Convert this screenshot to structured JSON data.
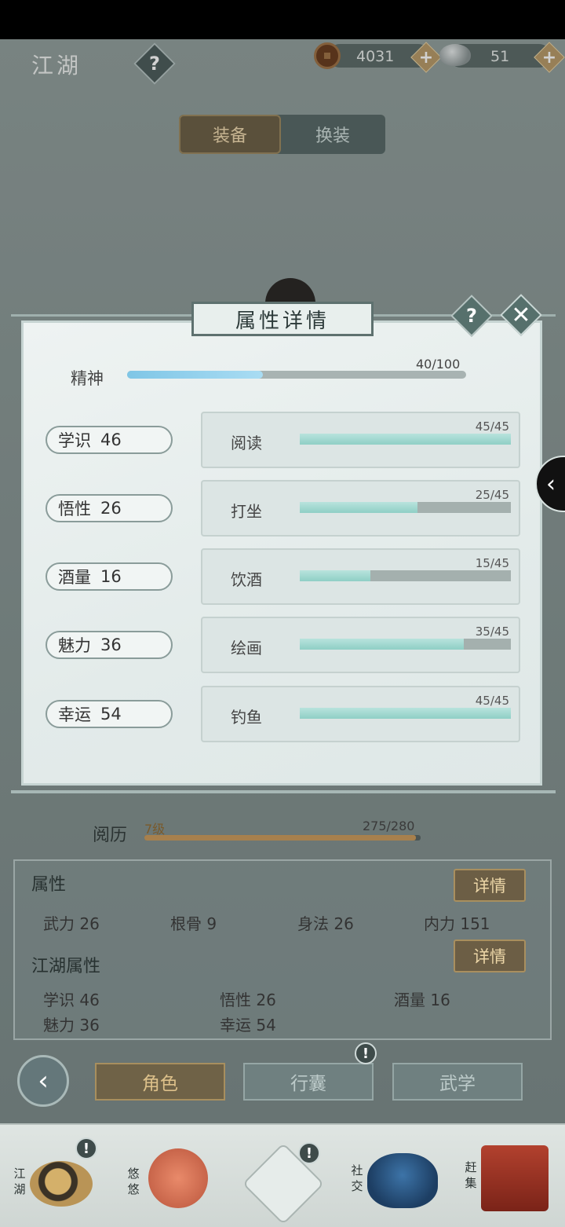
{
  "header": {
    "title": "江湖",
    "help_symbol": "?",
    "copper_coins": "4031",
    "silver_ingots": "51",
    "plus_symbol": "+"
  },
  "tabs": {
    "equip": "装备",
    "outfit": "换装"
  },
  "modal": {
    "title": "属性详情",
    "help_symbol": "?",
    "close_symbol": "✕",
    "spirit": {
      "label": "精神",
      "value": "40/100",
      "fraction": 0.4
    },
    "attributes": [
      {
        "name": "学识",
        "value": "46",
        "skill": "阅读",
        "skill_value": "45/45",
        "fraction": 1.0
      },
      {
        "name": "悟性",
        "value": "26",
        "skill": "打坐",
        "skill_value": "25/45",
        "fraction": 0.556
      },
      {
        "name": "酒量",
        "value": "16",
        "skill": "饮酒",
        "skill_value": "15/45",
        "fraction": 0.333
      },
      {
        "name": "魅力",
        "value": "36",
        "skill": "绘画",
        "skill_value": "35/45",
        "fraction": 0.778
      },
      {
        "name": "幸运",
        "value": "54",
        "skill": "钓鱼",
        "skill_value": "45/45",
        "fraction": 1.0
      }
    ]
  },
  "side_arrow": "‹",
  "experience": {
    "label": "阅历",
    "level": "7级",
    "value": "275/280",
    "fraction": 0.982
  },
  "attributes_panel": {
    "title": "属性",
    "detail_label": "详情",
    "stats": [
      {
        "name": "武力",
        "value": "26"
      },
      {
        "name": "根骨",
        "value": "9"
      },
      {
        "name": "身法",
        "value": "26"
      },
      {
        "name": "内力",
        "value": "151"
      }
    ],
    "jianghu_title": "江湖属性",
    "jianghu_detail_label": "详情",
    "jianghu_stats": [
      {
        "name": "学识",
        "value": "46"
      },
      {
        "name": "悟性",
        "value": "26"
      },
      {
        "name": "酒量",
        "value": "16"
      },
      {
        "name": "魅力",
        "value": "36"
      },
      {
        "name": "幸运",
        "value": "54"
      }
    ]
  },
  "bottom_tabs": {
    "back_symbol": "‹",
    "character": "角色",
    "bag": "行囊",
    "martial": "武学",
    "alert_symbol": "!"
  },
  "bottom_nav": {
    "jianghu": "江湖",
    "leisure": "悠悠",
    "social": "社交",
    "market": "赶集",
    "alert_symbol": "!"
  },
  "colors": {
    "accent_gold": "#a98f5e",
    "bar_teal": "#8fcfc5",
    "spirit_blue": "#7fc6e6"
  }
}
